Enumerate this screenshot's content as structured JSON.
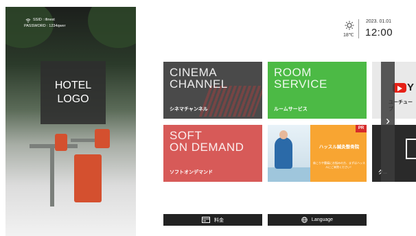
{
  "wifi": {
    "ssid": "SSID : ifinest",
    "password": "PASSWORD : 1234qwer"
  },
  "logo": {
    "line1": "HOTEL",
    "line2": "LOGO"
  },
  "weather": {
    "icon": "sun-icon",
    "temperature": "18℃"
  },
  "clock": {
    "date": "2023. 01.01",
    "time": "12:00"
  },
  "tiles": {
    "cinema": {
      "title1": "CINEMA",
      "title2": "CHANNEL",
      "subtitle": "シネマチャンネル"
    },
    "room": {
      "title1": "ROOM",
      "title2": "SERVICE",
      "subtitle": "ルームサービス"
    },
    "soft": {
      "title1": "SOFT",
      "title2": "ON DEMAND",
      "subtitle": "ソフトオンデマンド"
    },
    "ad": {
      "badge": "PR",
      "headline": "ハッスル鍼灸整骨院",
      "text": "肩こりや腰痛にお悩みの方、まずはハッスルにご来院ください！"
    },
    "youtube": {
      "letter": "Y",
      "subtitle": "ユーチューブ"
    },
    "partial": {
      "subtitle": "ク..."
    }
  },
  "buttons": {
    "fee": "料金",
    "language": "Language"
  },
  "colors": {
    "cinema": "#4a4a4a",
    "room": "#4cba45",
    "soft": "#d75a58",
    "ad": "#f8a532"
  }
}
